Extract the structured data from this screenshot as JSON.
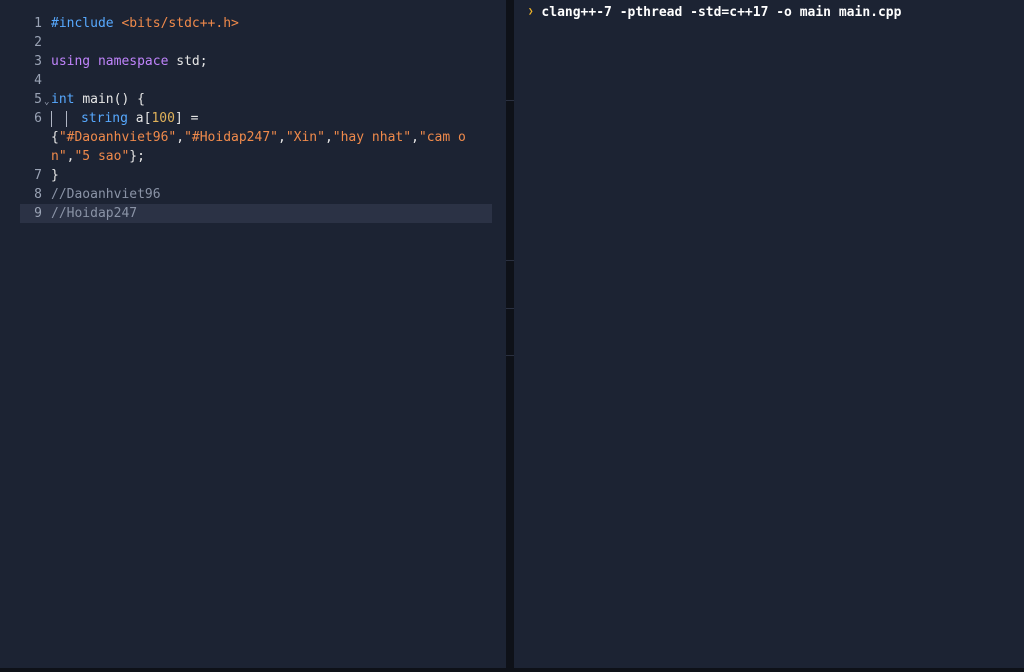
{
  "editor": {
    "lines": [
      {
        "num": "1",
        "include": "#include",
        "header": "<bits/stdc++.h>"
      },
      {
        "num": "2"
      },
      {
        "num": "3",
        "using": "using",
        "namespace": "namespace",
        "rest": "std;"
      },
      {
        "num": "4"
      },
      {
        "num": "5",
        "int": "int",
        "rest": "main() {"
      },
      {
        "num": "6",
        "type": "string",
        "var": "a[",
        "size": "100",
        "close": "] =",
        "brace_open": "{",
        "s1": "\"#Daoanhviet96\"",
        "s2": "\"#Hoidap247\"",
        "s3": "\"Xin\"",
        "s4": "\"hay nhat\"",
        "s5": "\"cam on\"",
        "s6": "\"5 sao\"",
        "end": "};",
        "comma": ","
      },
      {
        "num": "7",
        "rest": "}"
      },
      {
        "num": "8",
        "comment": "//Daoanhviet96"
      },
      {
        "num": "9",
        "comment": "//Hoidap247"
      }
    ]
  },
  "console": {
    "prompt_icon": "chevron-right-icon",
    "command": "clang++-7 -pthread -std=c++17 -o main main.cpp"
  },
  "colors": {
    "background": "#1c2333",
    "keyword_blue": "#57a9ff",
    "keyword_purple": "#c084fc",
    "string": "#f08a4b",
    "number": "#e0b25a",
    "comment": "#8a93a6",
    "prompt": "#f0b429"
  }
}
